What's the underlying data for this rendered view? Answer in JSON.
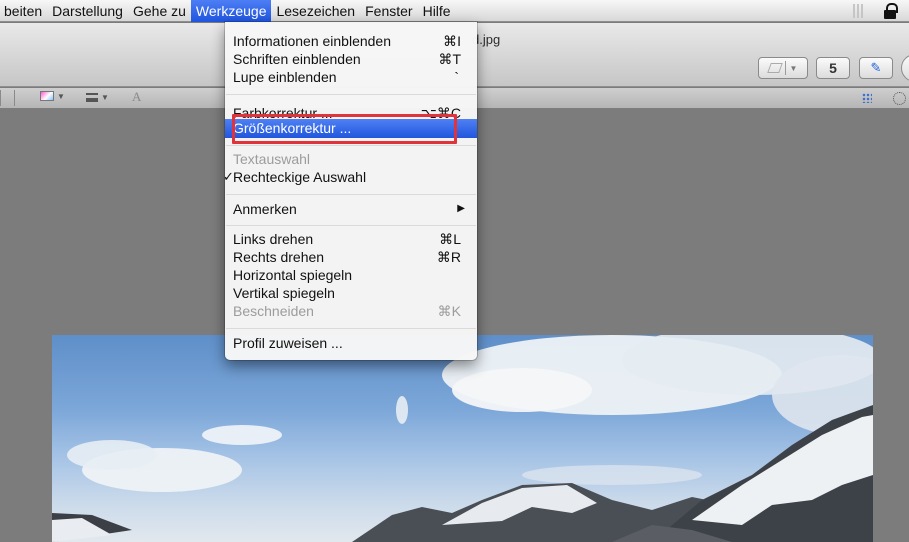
{
  "menubar": {
    "items": [
      "beiten",
      "Darstellung",
      "Gehe zu",
      "Werkzeuge",
      "Lesezeichen",
      "Fenster",
      "Hilfe"
    ],
    "active_index": 3
  },
  "window": {
    "title": "d.jpg"
  },
  "menu": {
    "items": [
      {
        "label": "Informationen einblenden",
        "shortcut": "⌘I"
      },
      {
        "label": "Schriften einblenden",
        "shortcut": "⌘T"
      },
      {
        "label": "Lupe einblenden",
        "shortcut": "`"
      },
      {
        "label": "Farbkorrektur ...",
        "shortcut": "⌥⌘C"
      },
      {
        "label": "Größenkorrektur ..."
      },
      {
        "label": "Textauswahl"
      },
      {
        "label": "Rechteckige Auswahl",
        "checked": true
      },
      {
        "label": "Anmerken",
        "submenu": true
      },
      {
        "label": "Links drehen",
        "shortcut": "⌘L"
      },
      {
        "label": "Rechts drehen",
        "shortcut": "⌘R"
      },
      {
        "label": "Horizontal spiegeln"
      },
      {
        "label": "Vertikal spiegeln"
      },
      {
        "label": "Beschneiden",
        "shortcut": "⌘K"
      },
      {
        "label": "Profil zuweisen ..."
      }
    ],
    "check_mark": "✓",
    "submenu_arrow": "▶"
  },
  "icons": {
    "rotate_glyph": "5",
    "annotate_glyph": "✎"
  },
  "colors": {
    "highlight": "#2f63e3",
    "callout": "#e0333a"
  }
}
